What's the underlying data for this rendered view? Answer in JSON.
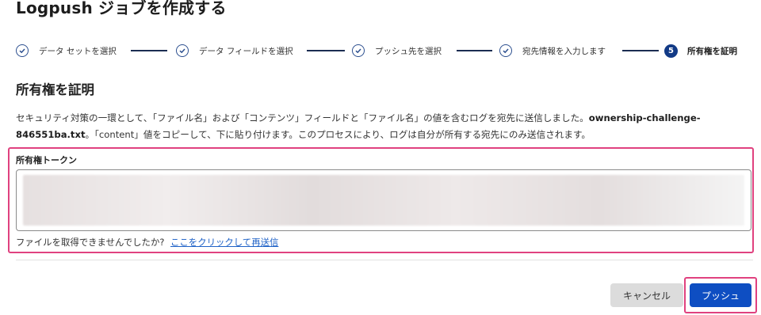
{
  "page": {
    "title": "Logpush ジョブを作成する"
  },
  "stepper": {
    "steps": [
      {
        "label": "データ セットを選択",
        "status": "complete"
      },
      {
        "label": "データ フィールドを選択",
        "status": "complete"
      },
      {
        "label": "プッシュ先を選択",
        "status": "complete"
      },
      {
        "label": "宛先情報を入力します",
        "status": "complete"
      },
      {
        "label": "所有権を証明",
        "status": "current",
        "number": "5"
      }
    ]
  },
  "section": {
    "title": "所有権を証明",
    "description_part1": "セキュリティ対策の一環として、「ファイル名」および「コンテンツ」フィールドと「ファイル名」の値を含むログを宛先に送信しました。",
    "description_filename": "ownership-challenge-846551ba.txt",
    "description_part2": "。「content」値をコピーして、下に貼り付けます。このプロセスにより、ログは自分が所有する宛先にのみ送信されます。"
  },
  "token": {
    "label": "所有権トークン",
    "value": ""
  },
  "help": {
    "text": "ファイルを取得できませんでしたか?",
    "link": "ここをクリックして再送信"
  },
  "actions": {
    "cancel_label": "キャンセル",
    "push_label": "プッシュ"
  },
  "colors": {
    "accent": "#0e4ec2",
    "step_active": "#123a86",
    "highlight": "#e0417f",
    "link": "#1f62c7"
  }
}
